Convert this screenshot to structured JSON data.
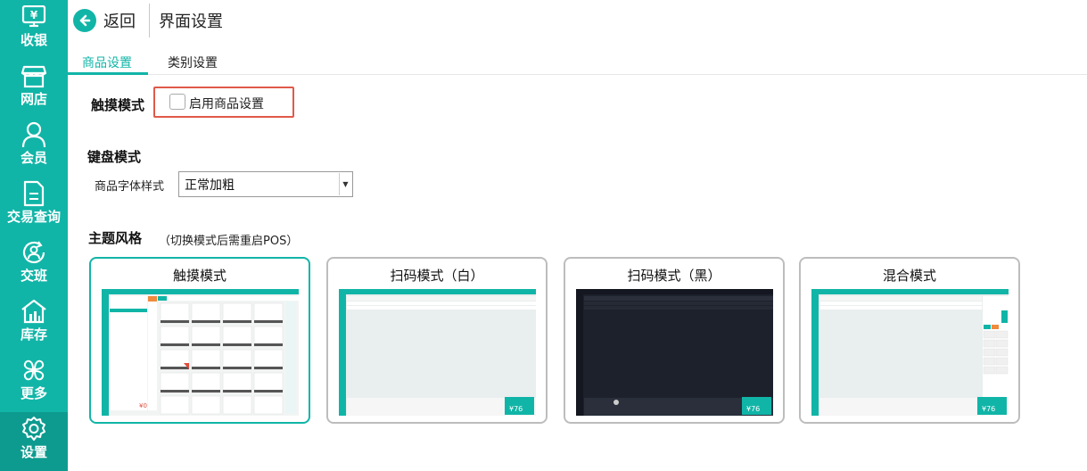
{
  "sidebar": {
    "items": [
      {
        "label": "收银",
        "icon": "cashier-icon"
      },
      {
        "label": "网店",
        "icon": "store-icon"
      },
      {
        "label": "会员",
        "icon": "member-icon"
      },
      {
        "label": "交易查询",
        "icon": "document-icon"
      },
      {
        "label": "交班",
        "icon": "shift-icon"
      },
      {
        "label": "库存",
        "icon": "warehouse-icon"
      },
      {
        "label": "更多",
        "icon": "more-icon"
      },
      {
        "label": "设置",
        "icon": "gear-icon"
      }
    ],
    "active": "设置",
    "color": "#11b5a7"
  },
  "header": {
    "back_label": "返回",
    "title": "界面设置"
  },
  "tabs": [
    {
      "label": "商品设置",
      "active": true
    },
    {
      "label": "类别设置",
      "active": false
    }
  ],
  "touch_mode": {
    "heading": "触摸模式",
    "checkbox_label": "启用商品设置",
    "checked": false
  },
  "keyboard_mode": {
    "heading": "键盘模式",
    "font_style_label": "商品字体样式",
    "font_style_value": "正常加粗"
  },
  "theme": {
    "heading": "主题风格",
    "hint": "（切换模式后需重启POS）",
    "cards": [
      {
        "title": "触摸模式",
        "selected": true,
        "preview": "touch"
      },
      {
        "title": "扫码模式（白）",
        "selected": false,
        "preview": "scan-white"
      },
      {
        "title": "扫码模式（黑）",
        "selected": false,
        "preview": "scan-black"
      },
      {
        "title": "混合模式",
        "selected": false,
        "preview": "mixed"
      }
    ]
  }
}
